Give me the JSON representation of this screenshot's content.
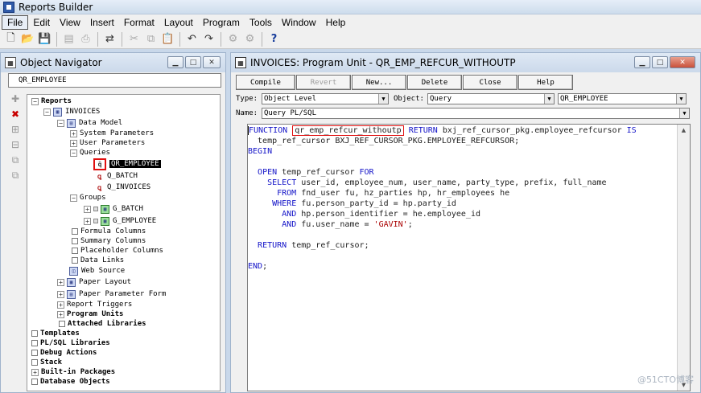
{
  "app": {
    "title": "Reports Builder"
  },
  "menu": [
    "File",
    "Edit",
    "View",
    "Insert",
    "Format",
    "Layout",
    "Program",
    "Tools",
    "Window",
    "Help"
  ],
  "navigator": {
    "title": "Object Navigator",
    "find_value": "QR_EMPLOYEE",
    "tree": {
      "reports": "Reports",
      "invoices": "INVOICES",
      "data_model": "Data Model",
      "system_parameters": "System Parameters",
      "user_parameters": "User Parameters",
      "queries": "Queries",
      "q1": "QR_EMPLOYEE",
      "q2": "Q_BATCH",
      "q3": "Q_INVOICES",
      "groups": "Groups",
      "g1": "G_BATCH",
      "g2": "G_EMPLOYEE",
      "formula_columns": "Formula Columns",
      "summary_columns": "Summary Columns",
      "placeholder_columns": "Placeholder Columns",
      "data_links": "Data Links",
      "web_source": "Web Source",
      "paper_layout": "Paper Layout",
      "paper_parameter_form": "Paper Parameter Form",
      "report_triggers": "Report Triggers",
      "program_units": "Program Units",
      "attached_libraries": "Attached Libraries",
      "templates": "Templates",
      "plsql_libraries": "PL/SQL Libraries",
      "debug_actions": "Debug Actions",
      "stack": "Stack",
      "builtin_packages": "Built-in Packages",
      "database_objects": "Database Objects"
    }
  },
  "editor": {
    "title": "INVOICES: Program Unit - QR_EMP_REFCUR_WITHOUTP",
    "buttons": {
      "compile": "Compile",
      "revert": "Revert",
      "new": "New...",
      "delete": "Delete",
      "close": "Close",
      "help": "Help"
    },
    "type_label": "Type:",
    "type_value": "Object Level",
    "object_label": "Object:",
    "object_value": "Query",
    "object2_value": "QR_EMPLOYEE",
    "name_label": "Name:",
    "name_value": "Query PL/SQL",
    "code": {
      "l1_kw": "FUNCTION",
      "l1_fn": "qr_emp_refcur_withoutp",
      "l1_ret": "RETURN",
      "l1_rest": " bxj_ref_cursor_pkg.employee_refcursor ",
      "l1_is": "IS",
      "l2": "  temp_ref_cursor BXJ_REF_CURSOR_PKG.EMPLOYEE_REFCURSOR;",
      "l3_kw": "BEGIN",
      "l5_kw": "OPEN",
      "l5_mid": " temp_ref_cursor ",
      "l5_for": "FOR",
      "l6_kw": "SELECT",
      "l6_rest": " user_id, employee_num, user_name, party_type, prefix, full_name",
      "l7_kw": "FROM",
      "l7_rest": " fnd_user fu, hz_parties hp, hr_employees he",
      "l8_kw": "WHERE",
      "l8_rest": " fu.person_party_id = hp.party_id",
      "l9_kw": "AND",
      "l9_rest": " hp.person_identifier = he.employee_id",
      "l10_kw": "AND",
      "l10_rest": " fu.user_name = ",
      "l10_str": "'GAVIN'",
      "l10_end": ";",
      "l12_kw": "RETURN",
      "l12_rest": " temp_ref_cursor;",
      "l14_kw": "END",
      "l14_end": ";"
    }
  },
  "watermark": "@51CTO博客"
}
